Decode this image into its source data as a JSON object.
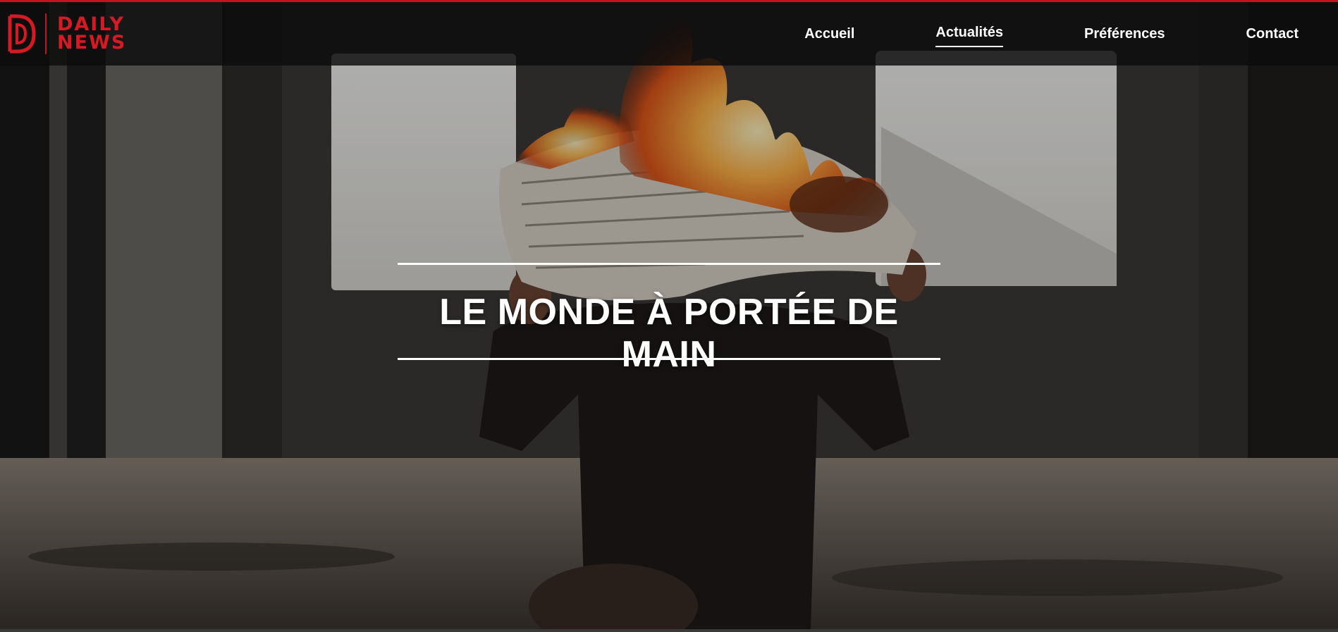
{
  "brand": {
    "logo_letter": "D",
    "name_line1": "DAILY",
    "name_line2": "NEWS",
    "accent_color": "#c8101e"
  },
  "nav": {
    "items": [
      {
        "label": "Accueil",
        "active": false
      },
      {
        "label": "Actualités",
        "active": true
      },
      {
        "label": "Préférences",
        "active": false
      },
      {
        "label": "Contact",
        "active": false
      }
    ]
  },
  "hero": {
    "title": "LE MONDE À PORTÉE DE MAIN",
    "image_subject": "person holding a burning newspaper"
  }
}
